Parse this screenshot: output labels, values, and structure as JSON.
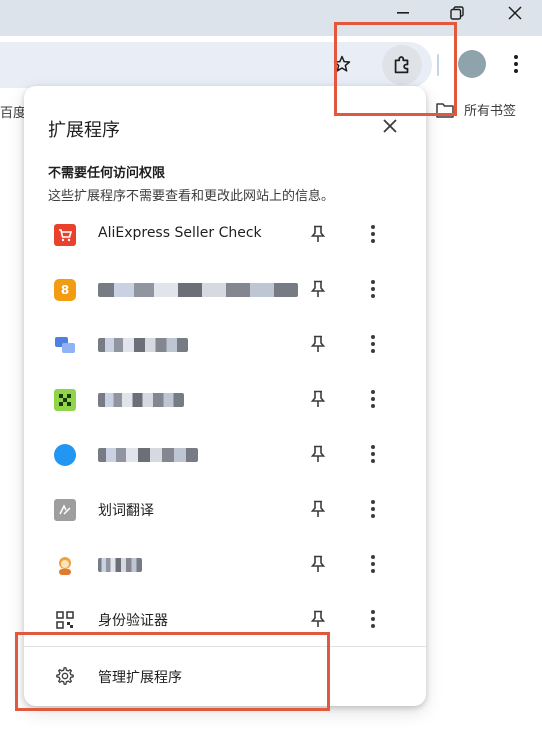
{
  "toolbar": {
    "bookmark_left_text": "百度",
    "all_bookmarks_label": "所有书签"
  },
  "popup": {
    "title": "扩展程序",
    "section_title": "不需要任何访问权限",
    "section_subtitle": "这些扩展程序不需要查看和更改此网站上的信息。",
    "extensions": [
      {
        "name": "AliExpress Seller Check",
        "icon": "aliexpress-cart-icon",
        "color": "#e8412c"
      },
      {
        "name": "",
        "icon": "orange-badge-icon",
        "color": "#f39c12",
        "glyph": "8"
      },
      {
        "name": "",
        "icon": "chat-bubble-icon",
        "color": "#4f7fe0"
      },
      {
        "name": "",
        "icon": "green-grid-icon",
        "color": "#8fd44a"
      },
      {
        "name": "",
        "icon": "blue-circle-icon",
        "color": "#2196f3"
      },
      {
        "name": "划词翻译",
        "icon": "translate-icon",
        "color": "#9e9e9e"
      },
      {
        "name": "",
        "icon": "character-icon",
        "color": "#f0a040"
      },
      {
        "name": "身份验证器",
        "icon": "qr-code-icon",
        "color": "#444444"
      }
    ],
    "manage_label": "管理扩展程序"
  },
  "colors": {
    "highlight": "#e2583d",
    "titlebar": "#dde3ea",
    "omnibox": "#e9eef6"
  }
}
